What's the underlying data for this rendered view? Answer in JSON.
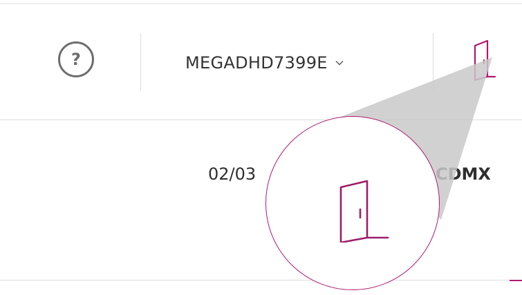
{
  "header": {
    "help_label": "?",
    "account_name": "MEGADHD7399E",
    "account_dropdown_icon": "chevron-down-icon",
    "logout_icon": "door-icon"
  },
  "row": {
    "date": "02/03",
    "city": "CDMX"
  },
  "colors": {
    "accent": "#b0186f",
    "icon_gray": "#6d6d6d",
    "divider": "#dcdcdc",
    "text": "#2e2e2e"
  }
}
